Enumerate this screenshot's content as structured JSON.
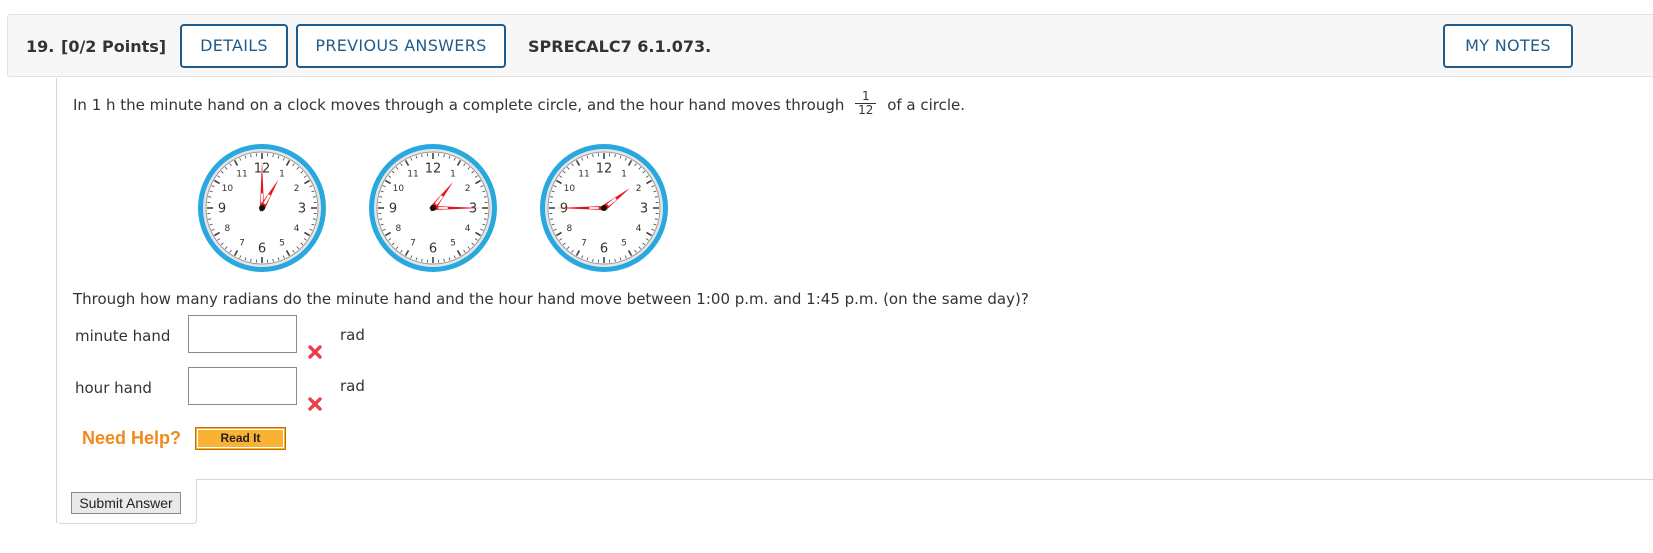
{
  "header": {
    "question_number": "19.",
    "points": "[0/2 Points]",
    "details_label": "DETAILS",
    "previous_answers_label": "PREVIOUS ANSWERS",
    "problem_code": "SPRECALC7 6.1.073.",
    "my_notes_label": "MY NOTES"
  },
  "question": {
    "prompt_before": "In 1 h the minute hand on a clock moves through a complete circle, and the hour hand moves through",
    "fraction_numerator": "1",
    "fraction_denominator": "12",
    "prompt_after": "of a circle.",
    "clocks": [
      {
        "time": "1:00",
        "hour_angle_deg": 30,
        "minute_angle_deg": 0
      },
      {
        "time": "1:15",
        "hour_angle_deg": 37.5,
        "minute_angle_deg": 90
      },
      {
        "time": "1:45",
        "hour_angle_deg": 52.5,
        "minute_angle_deg": 270
      }
    ],
    "clock_numerals": [
      "12",
      "1",
      "2",
      "3",
      "4",
      "5",
      "6",
      "7",
      "8",
      "9",
      "10",
      "11"
    ],
    "sub_question": "Through how many radians do the minute hand and the hour hand move between 1:00 p.m. and 1:45 p.m. (on the same day)?"
  },
  "answers": [
    {
      "label": "minute hand",
      "value": "",
      "unit": "rad",
      "status": "incorrect"
    },
    {
      "label": "hour hand",
      "value": "",
      "unit": "rad",
      "status": "incorrect"
    }
  ],
  "help": {
    "need_help_label": "Need Help?",
    "read_it_label": "Read It"
  },
  "submit_label": "Submit Answer",
  "colors": {
    "button_border": "#1f5c8b",
    "clock_rim": "#29a8e0",
    "hand": "#e8141b",
    "need_help": "#f08a1c",
    "read_it_bg": "#f9b233",
    "incorrect_x": "#e8404a"
  }
}
